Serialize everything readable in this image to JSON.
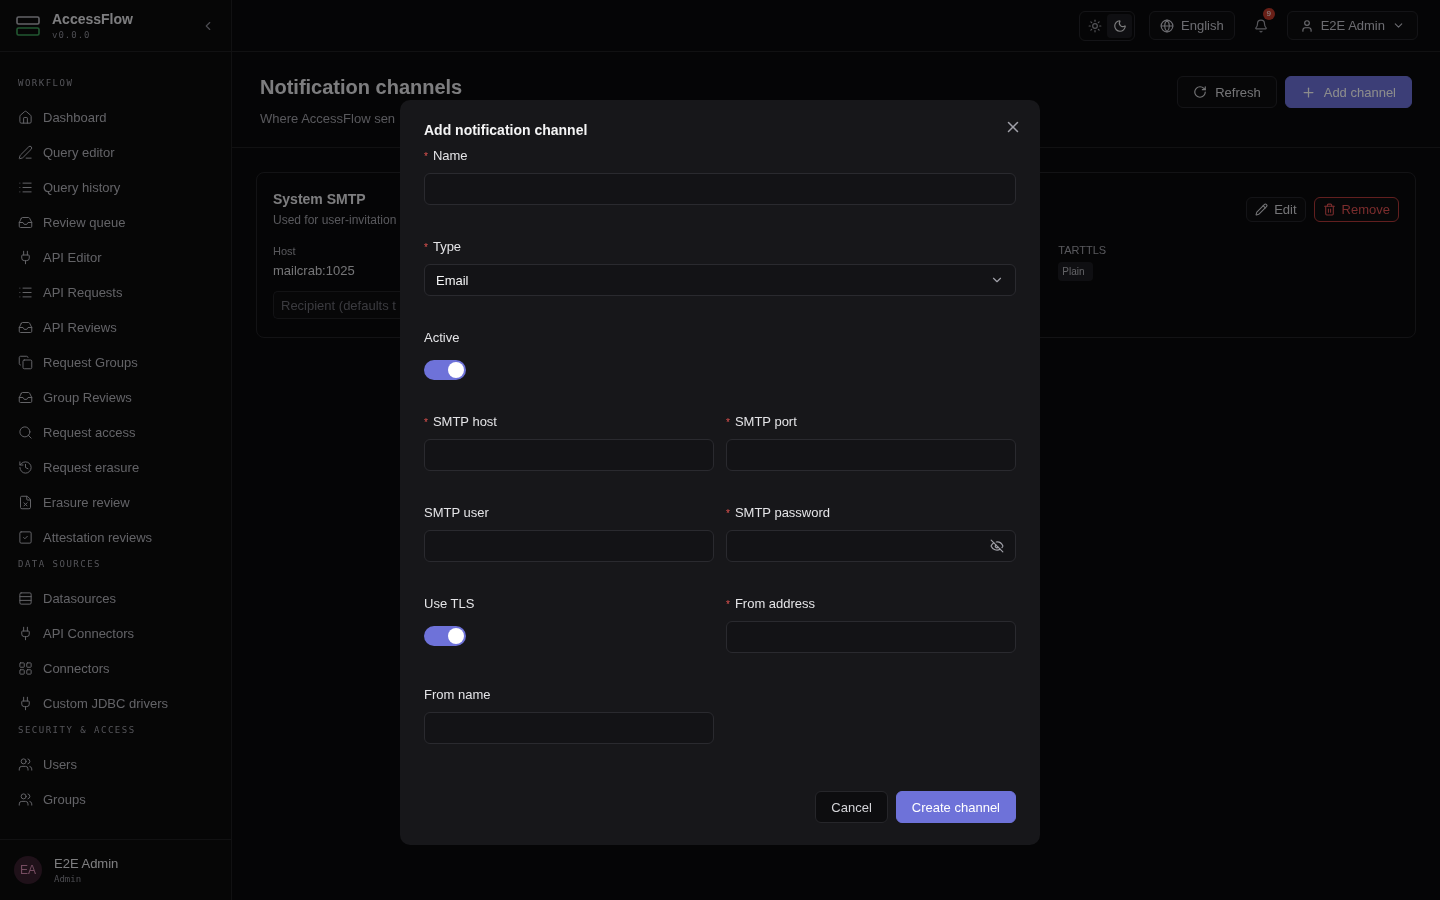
{
  "brand": {
    "name": "AccessFlow",
    "version": "v0.0.0"
  },
  "sidebar": {
    "sections": [
      {
        "title": "WORKFLOW",
        "items": [
          "Dashboard",
          "Query editor",
          "Query history",
          "Review queue",
          "API Editor",
          "API Requests",
          "API Reviews",
          "Request Groups",
          "Group Reviews",
          "Request access",
          "Request erasure",
          "Erasure review",
          "Attestation reviews"
        ]
      },
      {
        "title": "DATA SOURCES",
        "items": [
          "Datasources",
          "API Connectors",
          "Connectors",
          "Custom JDBC drivers"
        ]
      },
      {
        "title": "SECURITY & ACCESS",
        "items": [
          "Users",
          "Groups"
        ]
      }
    ],
    "user": {
      "initials": "EA",
      "name": "E2E Admin",
      "role": "Admin"
    }
  },
  "topbar": {
    "theme": [
      {
        "kind": "light",
        "selected": false
      },
      {
        "kind": "dark",
        "selected": true
      }
    ],
    "language": "English",
    "notifications": "9",
    "user": "E2E Admin"
  },
  "page": {
    "title": "Notification channels",
    "subtitle": "Where AccessFlow sen",
    "actions": [
      "Refresh",
      "Add channel"
    ]
  },
  "channel": {
    "name": "System SMTP",
    "description": "Used for user-invitation",
    "host_label": "Host",
    "host": "mailcrab:1025",
    "recipient_placeholder": "Recipient (defaults t",
    "column_2_label": "TARTTLS",
    "column_2_tag": "Plain",
    "actions": [
      "Edit",
      "Remove"
    ]
  },
  "dialog": {
    "title": "Add notification channel",
    "required_mark": "*",
    "rows": [
      [
        {
          "kind": "text",
          "label": "Name",
          "required": true
        }
      ],
      [
        {
          "kind": "select",
          "label": "Type",
          "required": true,
          "value": "Email"
        }
      ],
      [
        {
          "kind": "switch",
          "label": "Active",
          "required": false,
          "on": true
        }
      ],
      [
        {
          "kind": "text",
          "label": "SMTP host",
          "required": true
        },
        {
          "kind": "text",
          "label": "SMTP port",
          "required": true
        }
      ],
      [
        {
          "kind": "text",
          "label": "SMTP user",
          "required": false
        },
        {
          "kind": "password",
          "label": "SMTP password",
          "required": true
        }
      ],
      [
        {
          "kind": "switch",
          "label": "Use TLS",
          "required": false,
          "on": true
        },
        {
          "kind": "text",
          "label": "From address",
          "required": true
        }
      ],
      [
        {
          "kind": "text",
          "label": "From name",
          "required": false
        }
      ]
    ],
    "buttons": [
      "Cancel",
      "Create channel"
    ]
  }
}
